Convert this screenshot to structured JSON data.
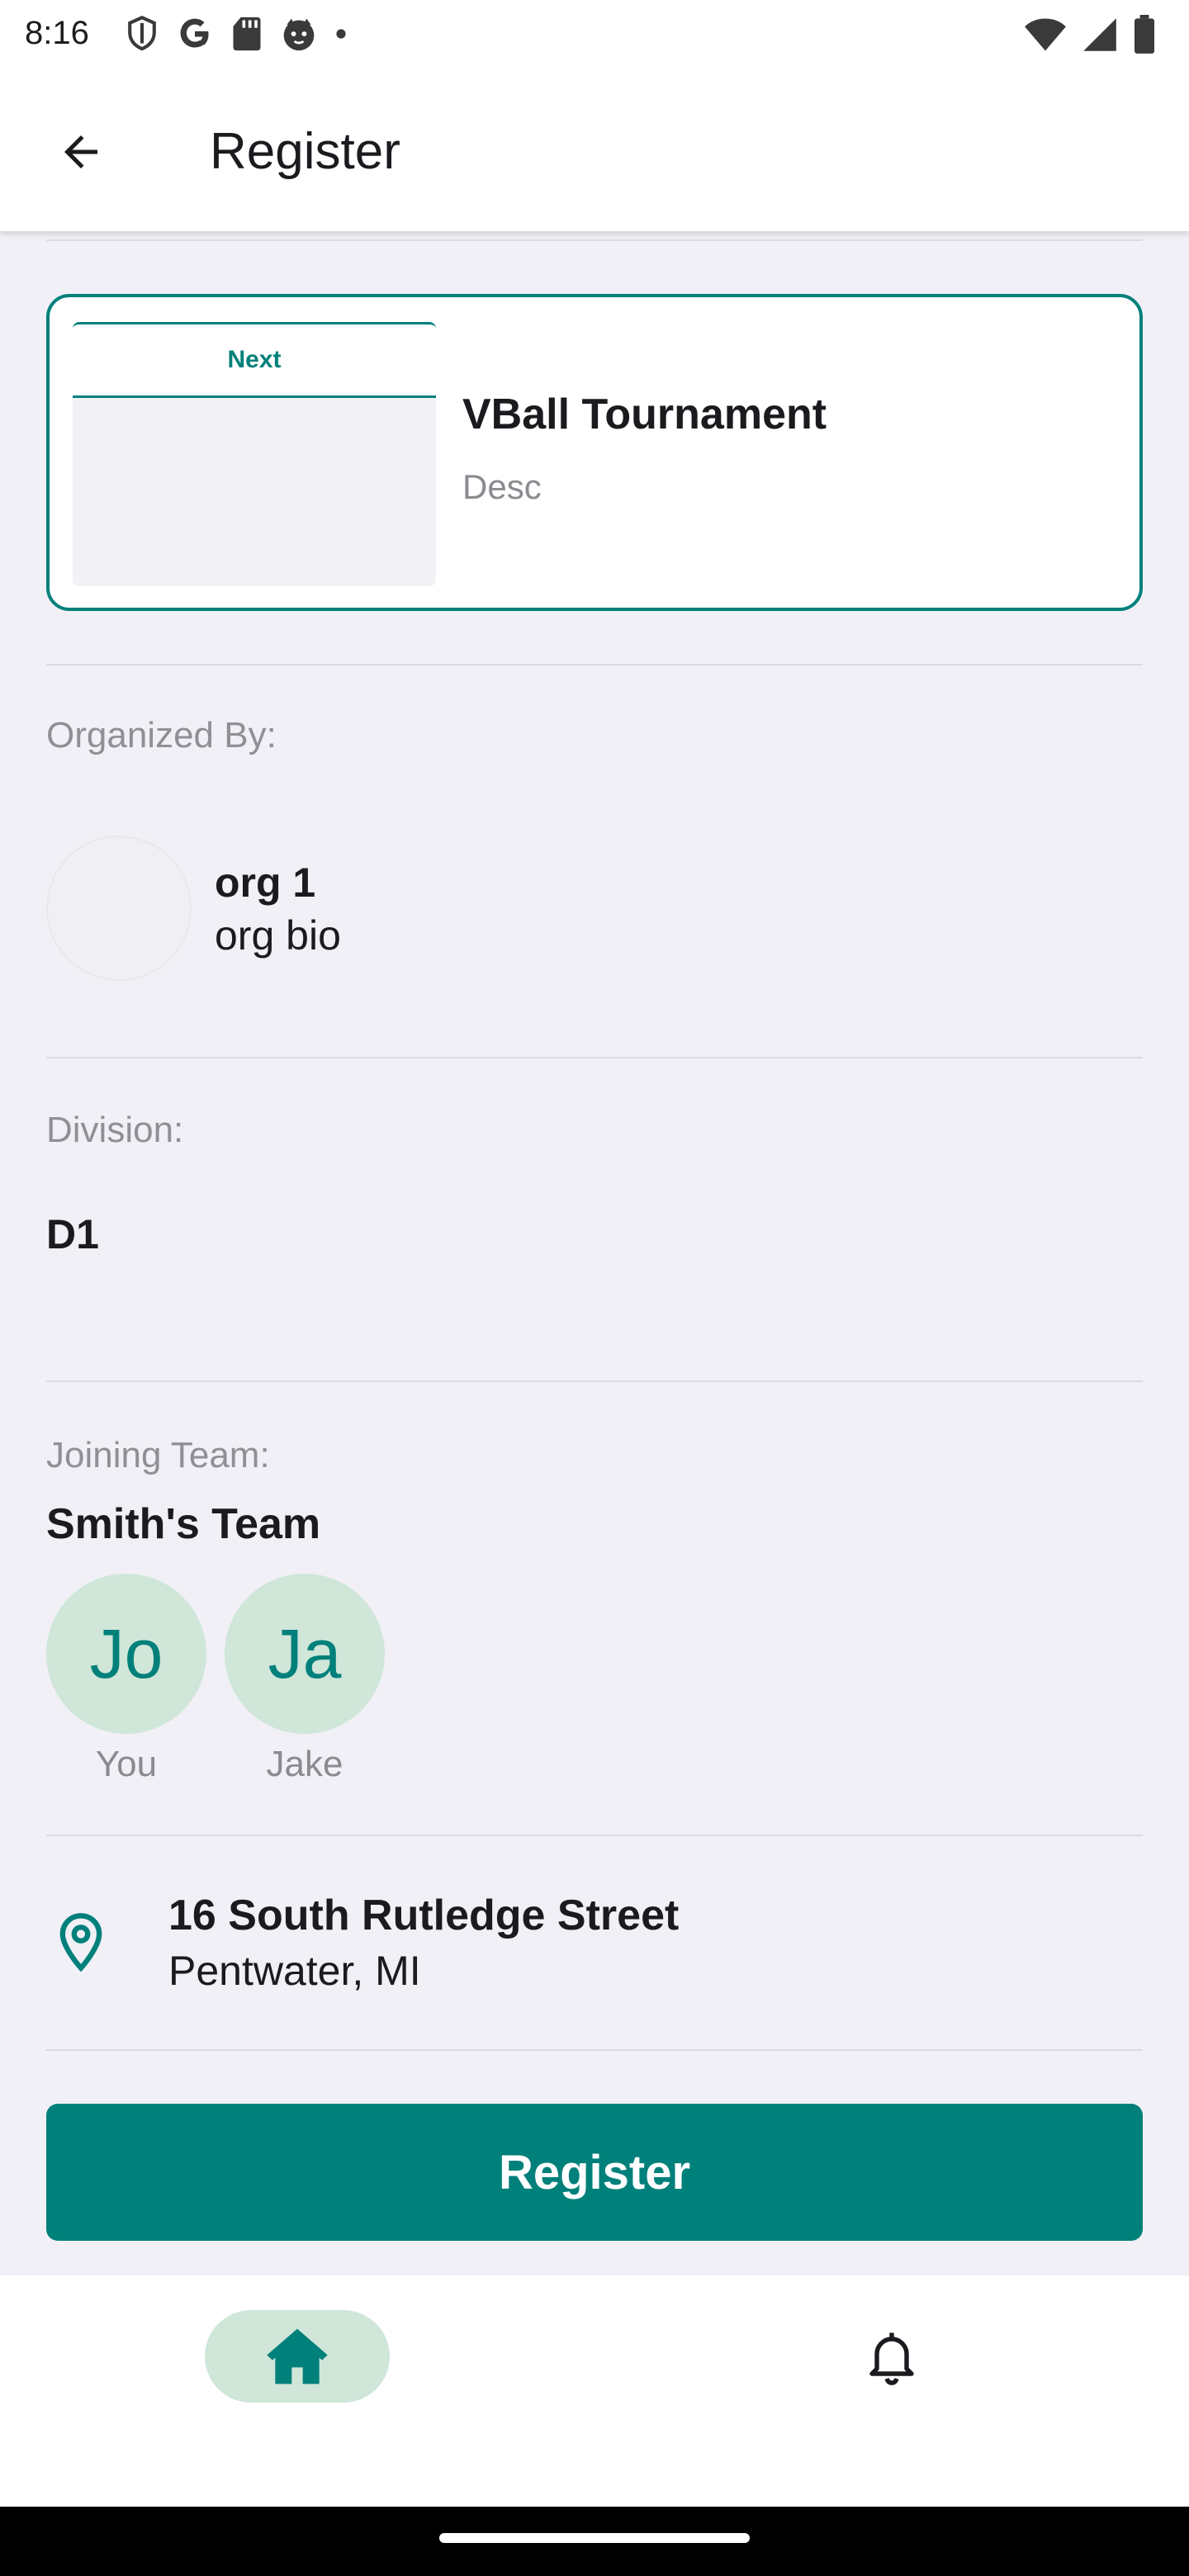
{
  "status_bar": {
    "time": "8:16",
    "left_icons": [
      "shield-icon",
      "google-icon",
      "sd-card-icon",
      "cat-face-icon",
      "dot-icon"
    ],
    "right_icons": [
      "wifi-icon",
      "signal-icon",
      "battery-icon"
    ]
  },
  "app_bar": {
    "back_icon": "arrow-left-icon",
    "title": "Register"
  },
  "event": {
    "thumb_tab": "Next",
    "name": "VBall Tournament",
    "description": "Desc"
  },
  "organizer": {
    "label": "Organized By:",
    "name": "org 1",
    "bio": "org bio"
  },
  "division": {
    "label": "Division:",
    "value": "D1"
  },
  "team": {
    "label": "Joining Team:",
    "name": "Smith's Team",
    "members": [
      {
        "initials": "Jo",
        "name": "You"
      },
      {
        "initials": "Ja",
        "name": "Jake"
      }
    ]
  },
  "location": {
    "icon": "location-pin-icon",
    "line1": "16 South Rutledge Street",
    "line2": "Pentwater, MI"
  },
  "actions": {
    "register_label": "Register"
  },
  "bottom_nav": {
    "items": [
      {
        "icon": "home-icon",
        "selected": true
      },
      {
        "icon": "bell-icon",
        "selected": false
      }
    ]
  },
  "colors": {
    "accent": "#00807b",
    "accent_light": "#cfe6d9",
    "background": "#f1f0f6"
  }
}
